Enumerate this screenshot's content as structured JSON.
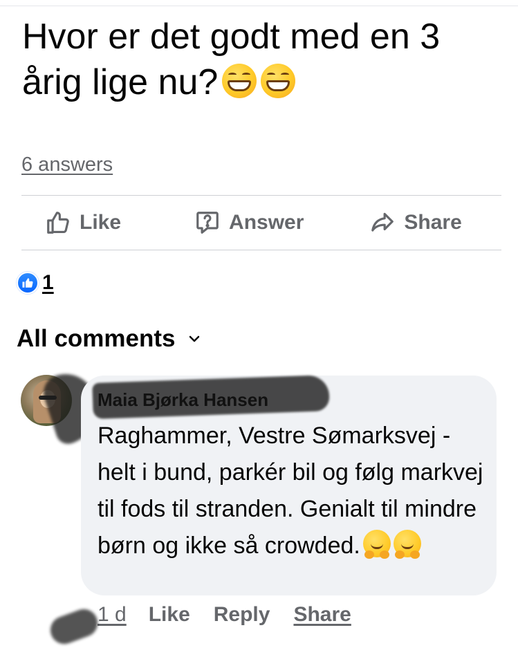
{
  "post": {
    "text": "Hvor er det godt med en 3 årig lige nu?",
    "answers_link": "6 answers"
  },
  "actions": {
    "like": "Like",
    "answer": "Answer",
    "share": "Share"
  },
  "reactions": {
    "count": "1"
  },
  "comments_header": {
    "label": "All comments"
  },
  "comment": {
    "author": "Maia Bjørka Hansen",
    "text": "Raghammer, Vestre Sømarksvej - helt i bund, parkér bil og følg markvej til fods til stranden. Genialt til mindre børn og ikke så crowded.",
    "time": "1 d",
    "like": "Like",
    "reply": "Reply",
    "share": "Share"
  },
  "colors": {
    "secondary_text": "#65676b",
    "bubble": "#f0f2f5",
    "like_blue": "#0866ff",
    "divider": "#ced0d4"
  },
  "icons": [
    "thumbs-up-icon",
    "question-bubble-icon",
    "share-arrow-icon",
    "like-reaction-icon",
    "chevron-down-icon",
    "grinning-face-emoji",
    "hugging-face-emoji"
  ]
}
